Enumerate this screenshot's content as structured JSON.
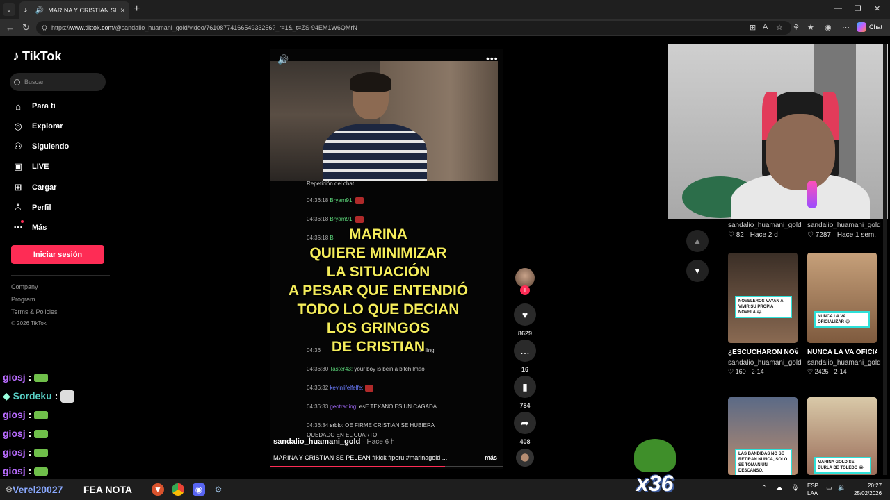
{
  "browser": {
    "tab_title": "MARINA Y CRISTIAN SE PELEAN",
    "url_prefix": "https://",
    "url_domain": "www.tiktok.com",
    "url_path": "/@sandalio_huamani_gold/video/7610877416654933256?_r=1&_t=ZS-94EM1W6QMrN",
    "chat_label": "Chat"
  },
  "sidebar": {
    "logo": "TikTok",
    "search_placeholder": "Buscar",
    "items": [
      {
        "label": "Para ti",
        "icon": "home-icon"
      },
      {
        "label": "Explorar",
        "icon": "compass-icon"
      },
      {
        "label": "Siguiendo",
        "icon": "following-icon"
      },
      {
        "label": "LIVE",
        "icon": "live-icon"
      },
      {
        "label": "Cargar",
        "icon": "upload-icon"
      },
      {
        "label": "Perfil",
        "icon": "profile-icon"
      },
      {
        "label": "Más",
        "icon": "more-dots-icon"
      }
    ],
    "login_label": "Iniciar sesión",
    "footer": [
      "Company",
      "Program",
      "Terms & Policies",
      "© 2026 TikTok"
    ]
  },
  "video": {
    "replay_label": "Repetición del chat",
    "chat_lines": [
      {
        "time": "04:36:18",
        "user": "Bryam91:",
        "msg": ""
      },
      {
        "time": "04:36:18",
        "user": "Bryam91:",
        "msg": ""
      },
      {
        "time": "04:36:18",
        "user": "B",
        "msg": ""
      },
      {
        "time": "04:36",
        "user": "",
        "msg": "rolling"
      },
      {
        "time": "04:36:30",
        "user": "Taster43:",
        "msg": "your boy is bein   a bitch lmao"
      },
      {
        "time": "04:36:32",
        "user": "kevinlifelfelfe:",
        "msg": ""
      },
      {
        "time": "04:36:33",
        "user": "geotrading:",
        "msg": "esE TEXANO ES UN CAGADA"
      },
      {
        "time": "04:36:34",
        "user": "srblo:",
        "msg": "OE FIRME CRISTIAN SE HUBIERA"
      }
    ],
    "chat_tail": "QUEDADO EN EL CUARTO",
    "caption_lines": [
      "MARINA",
      "QUIERE MINIMIZAR",
      "LA SITUACIÓN",
      "A PESAR QUE ENTENDIÓ",
      "TODO LO QUE DECIAN",
      "LOS GRINGOS",
      "DE CRISTIAN"
    ],
    "author": "sandalio_huamani_gold",
    "time_ago": "· Hace 6 h",
    "description": "MARINA Y CRISTIAN SE PELEAN #kick #peru #marinagold ...",
    "more_label": "más",
    "progress": 0.75
  },
  "actions": {
    "likes": "8629",
    "comments": "16",
    "saves": "784",
    "shares": "408"
  },
  "recommendations": {
    "top_row": [
      {
        "user": "sandalio_huamani_gold",
        "meta": "82 · Hace 2 d"
      },
      {
        "user": "sandalio_huamani_gold",
        "meta": "7287 · Hace 1 sem."
      }
    ],
    "cards": [
      {
        "badge": "NOVELEROS VAYAN A VIVIR SU PROPIA NOVELA 😂",
        "title": "¿ESCUCHARON NOVELEROS?...",
        "user": "sandalio_huamani_gold",
        "likes": "160",
        "date": "· 2-14"
      },
      {
        "badge": "NUNCA LA VA OFICIALIZAR 😂",
        "title": "NUNCA LA VA OFICIALIZAR 😂...",
        "user": "sandalio_huamani_gold",
        "likes": "2425",
        "date": "· 2-14"
      },
      {
        "badge": "LAS BANDIDAS NO SE RETIRAN NUNCA, SOLO SE TOMAN UN DESCANSO.",
        "title": "",
        "user": "",
        "likes": "",
        "date": ""
      },
      {
        "badge": "MARINA GOLD SE BURLA DE TOLEDO 😂",
        "title": "",
        "user": "",
        "likes": "",
        "date": ""
      }
    ]
  },
  "overlay_chat": [
    {
      "user": "giosj",
      "kind": "emote"
    },
    {
      "user": "Sordeku",
      "kind": "cat"
    },
    {
      "user": "giosj",
      "kind": "emote"
    },
    {
      "user": "giosj",
      "kind": "emote"
    },
    {
      "user": "giosj",
      "kind": "emote"
    },
    {
      "user": "giosj",
      "kind": "emote"
    }
  ],
  "overlay": {
    "combo": "x36",
    "bottom_user": "Verel20027",
    "bottom_text": "FEA NOTA"
  },
  "taskbar": {
    "lang": "ESP",
    "lang2": "LAA",
    "time": "20:27",
    "date": "25/02/2026"
  },
  "colors": {
    "tiktok_red": "#fe2c55",
    "caption_yellow": "#f4ec5a",
    "badge_cyan": "#2de0d8"
  }
}
